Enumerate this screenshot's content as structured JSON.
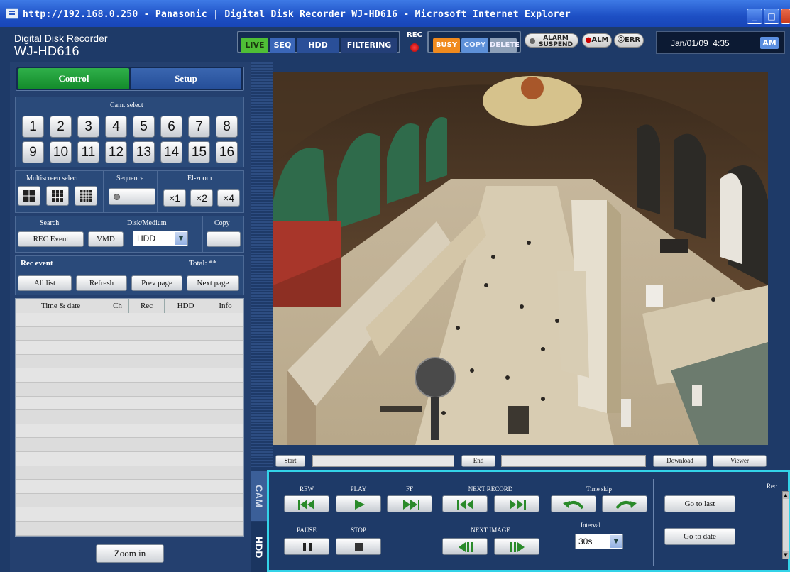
{
  "window": {
    "title": "http://192.168.0.250 - Panasonic | Digital Disk Recorder WJ-HD616 - Microsoft Internet Explorer",
    "min_glyph": "_",
    "max_glyph": "□",
    "close_glyph": "×"
  },
  "header": {
    "product_line": "Digital Disk Recorder",
    "model": "WJ-HD616",
    "modes": [
      "LIVE",
      "SEQ",
      "HDD",
      "FILTERING"
    ],
    "rec_label": "REC",
    "status": [
      "BUSY",
      "COPY",
      "DELETE"
    ],
    "alarm_suspend_line1": "ALARM",
    "alarm_suspend_line2": "SUSPEND",
    "alm_label": "ALM",
    "err_label": "ERR",
    "datetime": "Jan/01/09  4:35",
    "ampm": "AM"
  },
  "tabs": {
    "control": "Control",
    "setup": "Setup"
  },
  "cam_select": {
    "title": "Cam. select",
    "cameras": [
      "1",
      "2",
      "3",
      "4",
      "5",
      "6",
      "7",
      "8",
      "9",
      "10",
      "11",
      "12",
      "13",
      "14",
      "15",
      "16"
    ]
  },
  "multiscreen": {
    "title": "Multiscreen select"
  },
  "sequence": {
    "title": "Sequence"
  },
  "el_zoom": {
    "title": "El-zoom",
    "levels": [
      "×1",
      "×2",
      "×4"
    ]
  },
  "search": {
    "title": "Search",
    "rec_event": "REC Event",
    "vmd": "VMD"
  },
  "disk_medium": {
    "title": "Disk/Medium",
    "selected": "HDD"
  },
  "copy": {
    "title": "Copy"
  },
  "rec_event": {
    "title": "Rec event",
    "total": "Total: **",
    "buttons": [
      "All list",
      "Refresh",
      "Prev page",
      "Next page"
    ],
    "columns": [
      "Time & date",
      "Ch",
      "Rec",
      "HDD",
      "Info"
    ]
  },
  "zoom_in": "Zoom in",
  "timeline": {
    "start": "Start",
    "end": "End",
    "download": "Download",
    "viewer": "Viewer"
  },
  "side_tabs": {
    "cam_tab": "CAM",
    "hdd_tab": "HDD"
  },
  "playback": {
    "rew": "REW",
    "play": "PLAY",
    "ff": "FF",
    "next_record": "NEXT RECORD",
    "time_skip": "Time skip",
    "pause": "PAUSE",
    "stop": "STOP",
    "next_image": "NEXT IMAGE",
    "interval_label": "Interval",
    "interval_value": "30s",
    "go_to_last": "Go to last",
    "go_to_date": "Go to date",
    "rec_label": "Rec"
  }
}
